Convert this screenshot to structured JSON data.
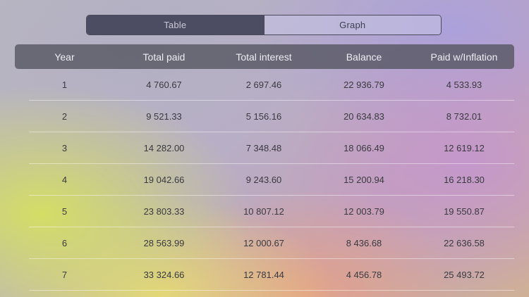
{
  "view_toggle": {
    "table_label": "Table",
    "graph_label": "Graph"
  },
  "columns": [
    "Year",
    "Total paid",
    "Total interest",
    "Balance",
    "Paid w/Inflation"
  ],
  "rows": [
    [
      "1",
      "4 760.67",
      "2 697.46",
      "22 936.79",
      "4 533.93"
    ],
    [
      "2",
      "9 521.33",
      "5 156.16",
      "20 634.83",
      "8 732.01"
    ],
    [
      "3",
      "14 282.00",
      "7 348.48",
      "18 066.49",
      "12 619.12"
    ],
    [
      "4",
      "19 042.66",
      "9 243.60",
      "15 200.94",
      "16 218.30"
    ],
    [
      "5",
      "23 803.33",
      "10 807.12",
      "12 003.79",
      "19 550.87"
    ],
    [
      "6",
      "28 563.99",
      "12 000.67",
      "8 436.68",
      "22 636.58"
    ],
    [
      "7",
      "33 324.66",
      "12 781.44",
      "4 456.78",
      "25 493.72"
    ]
  ],
  "colors": {
    "segment_selected": "#4c4d62",
    "header_background": "#58586a",
    "header_text": "#ededf2",
    "cell_text": "#3a3a40"
  }
}
